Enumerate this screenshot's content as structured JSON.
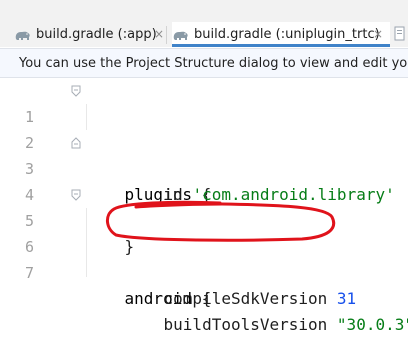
{
  "tabs": [
    {
      "label": "build.gradle (:app)",
      "active": false,
      "close": "×",
      "icon": "gradle-elephant-icon"
    },
    {
      "label": "build.gradle (:uniplugin_trtc)",
      "active": true,
      "close": "×",
      "icon": "gradle-elephant-icon"
    }
  ],
  "banner": {
    "text": "You can use the Project Structure dialog to view and edit your project"
  },
  "code": {
    "line_numbers": [
      "1",
      "2",
      "3",
      "4",
      "5",
      "6",
      "7"
    ],
    "line1": {
      "kw": "plugins",
      "rest": " {"
    },
    "line2": {
      "fn": "id ",
      "str": "'com.android.library'"
    },
    "line3": {
      "brace": "}"
    },
    "line5": {
      "kw": "android",
      "rest": " {"
    },
    "line6": {
      "prop": "compileSdkVersion ",
      "num": "31"
    },
    "line7": {
      "prop": "buildToolsVersion ",
      "str": "\"30.0.3\""
    }
  },
  "colors": {
    "active_tab_underline": "#4083c9",
    "string": "#067d17",
    "number": "#1750eb",
    "annotation": "#e0131b"
  }
}
